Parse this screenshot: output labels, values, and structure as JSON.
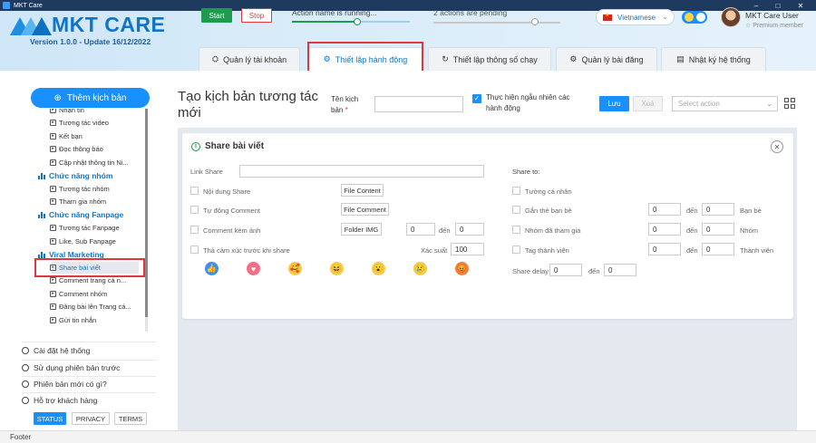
{
  "window": {
    "title": "MKT Care"
  },
  "header": {
    "logo_text": "MKT CARE",
    "version": "Version 1.0.0 - Update 16/12/2022",
    "start_label": "Start",
    "stop_label": "Stop",
    "running_text": "Action name is running...",
    "running_progress": 0.55,
    "pending_text": "2 actions are pending",
    "pending_progress": 0.8,
    "language": "Vietnamese",
    "user_name": "MKT Care User",
    "user_tier": "☆ Premium member",
    "dark_mode_on": true
  },
  "tabs": [
    {
      "label": "Quản lý tài khoản",
      "icon": "users-icon"
    },
    {
      "label": "Thiết lập hành động",
      "icon": "gear-icon",
      "active": true
    },
    {
      "label": "Thiết lập thông số chạy",
      "icon": "refresh-icon"
    },
    {
      "label": "Quản lý bài đăng",
      "icon": "gear-icon"
    },
    {
      "label": "Nhật ký hệ thống",
      "icon": "log-icon"
    }
  ],
  "sidebar": {
    "add_button": "Thêm kịch bản",
    "tree": [
      {
        "type": "item",
        "label": "Nhận tin"
      },
      {
        "type": "item",
        "label": "Tương tác video"
      },
      {
        "type": "item",
        "label": "Kết bạn"
      },
      {
        "type": "item",
        "label": "Đọc thông báo"
      },
      {
        "type": "item",
        "label": "Cập nhật thông tin Ni..."
      },
      {
        "type": "group",
        "label": "Chức năng nhóm"
      },
      {
        "type": "item",
        "label": "Tương tác nhóm"
      },
      {
        "type": "item",
        "label": "Tham gia nhóm"
      },
      {
        "type": "group",
        "label": "Chức năng Fanpage"
      },
      {
        "type": "item",
        "label": "Tương tác Fanpage"
      },
      {
        "type": "item",
        "label": "Like, Sub Fanpage"
      },
      {
        "type": "group",
        "label": "Viral Marketing"
      },
      {
        "type": "item",
        "label": "Share bài viết",
        "selected": true
      },
      {
        "type": "item",
        "label": "Comment trang cá n..."
      },
      {
        "type": "item",
        "label": "Comment nhóm"
      },
      {
        "type": "item",
        "label": "Đăng bài lên Trang cá..."
      },
      {
        "type": "item",
        "label": "Gửi tin nhắn"
      }
    ],
    "footer_links": [
      {
        "label": "Cài đặt hệ thống",
        "icon": "settings-icon"
      },
      {
        "label": "Sử dụng phiên bản trước",
        "icon": "history-icon"
      },
      {
        "label": "Phiên bản mới có gì?",
        "icon": "megaphone-icon"
      },
      {
        "label": "Hỗ trợ khách hàng",
        "icon": "help-icon"
      }
    ],
    "tags": [
      "STATUS",
      "PRIVACY",
      "TERMS"
    ]
  },
  "toolbar": {
    "page_title": "Tạo kịch bản tương tác mới",
    "name_label": "Tên kịch bản",
    "name_required": "*",
    "name_value": "",
    "random_label": "Thực hiện ngẫu nhiên các hành động",
    "random_checked": true,
    "save_label": "Lưu",
    "delete_label": "Xoá",
    "select_placeholder": "Select action"
  },
  "card": {
    "title": "Share bài viết",
    "link_label": "Link Share",
    "link_value": "",
    "left": {
      "content_label": "Nội dung Share",
      "content_btn": "File Content",
      "auto_comment_label": "Tự động Comment",
      "comment_btn": "File Comment",
      "image_label": "Comment kèm ảnh",
      "image_btn": "Folder IMG",
      "image_from": "0",
      "image_to_label": "đến",
      "image_to": "0",
      "emotion_label": "Thả cảm xúc trước khi share",
      "probability_label": "Xác suất",
      "probability": "100"
    },
    "right": {
      "share_to_label": "Share to:",
      "wall_label": "Tường cá nhân",
      "tag_friends_label": "Gắn thẻ bạn bè",
      "tag_friends_from": "0",
      "tag_friends_to": "0",
      "tag_friends_unit": "Bạn bè",
      "groups_label": "Nhóm đã tham gia",
      "groups_from": "0",
      "groups_to": "0",
      "groups_unit": "Nhóm",
      "members_label": "Tag thành viên",
      "members_from": "0",
      "members_to": "0",
      "members_unit": "Thành viên",
      "delay_label": "Share delay",
      "delay_from": "0",
      "delay_to": "0",
      "to_label": "đến"
    },
    "reactions": [
      "👍",
      "♥",
      "🥰",
      "😆",
      "😮",
      "😢",
      "😡"
    ]
  },
  "footer": {
    "text": "Footer"
  },
  "colors": {
    "primary": "#1890ff",
    "brand": "#1274c8",
    "danger": "#e0363f",
    "success": "#1e9b4f"
  }
}
